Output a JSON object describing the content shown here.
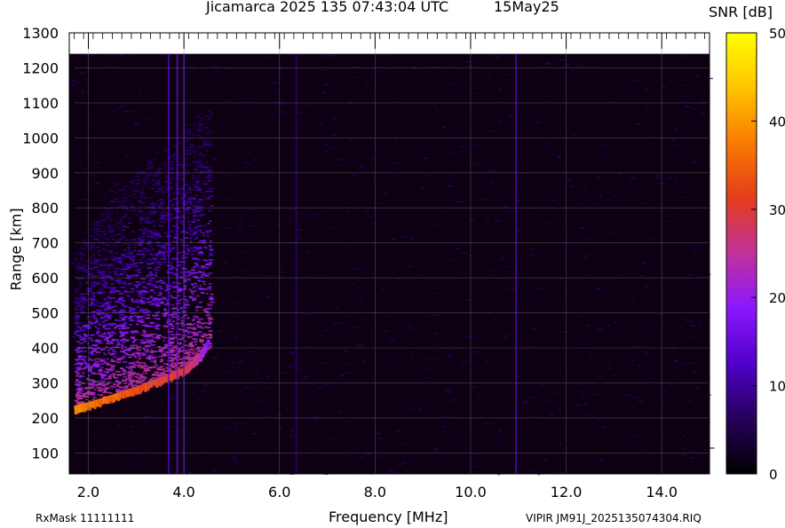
{
  "title": "Jicamarca 2025 135 07:43:04 UTC",
  "date": "15May25",
  "footer": {
    "rx_mask": "RxMask 11111111",
    "file_id": "VIPIR  JM91J_2025135074304.RIQ"
  },
  "chart_data": {
    "type": "heatmap",
    "xlabel": "Frequency [MHz]",
    "ylabel": "Range [km]",
    "xlim": [
      1.6,
      15.0
    ],
    "ylim": [
      40,
      1300
    ],
    "xticks": [
      2.0,
      4.0,
      6.0,
      8.0,
      10.0,
      12.0,
      14.0
    ],
    "xtick_labels": [
      "2.0",
      "4.0",
      "6.0",
      "8.0",
      "10.0",
      "12.0",
      "14.0"
    ],
    "yticks": [
      100,
      200,
      300,
      400,
      500,
      600,
      700,
      800,
      900,
      1000,
      1100,
      1200,
      1300
    ],
    "ytick_labels": [
      "100",
      "200",
      "300",
      "400",
      "500",
      "600",
      "700",
      "800",
      "900",
      "1000",
      "1100",
      "1200",
      "1300"
    ],
    "data_range_max": 1240,
    "grid": true,
    "colorbar": {
      "label": "SNR [dB]",
      "min": 0,
      "max": 50,
      "ticks": [
        0,
        10,
        20,
        30,
        40,
        50
      ],
      "tick_labels": [
        "0",
        "10",
        "20",
        "30",
        "40",
        "50"
      ],
      "colors": [
        "#000000",
        "#26005a",
        "#5000c8",
        "#8a18ff",
        "#c0329a",
        "#e33d1c",
        "#f87a00",
        "#ffc400",
        "#ffff00"
      ]
    },
    "trace": {
      "description_points": [
        {
          "f": 1.7,
          "r": 230,
          "snr": 36
        },
        {
          "f": 2.0,
          "r": 240,
          "snr": 34
        },
        {
          "f": 2.5,
          "r": 262,
          "snr": 32
        },
        {
          "f": 3.0,
          "r": 285,
          "snr": 30
        },
        {
          "f": 3.5,
          "r": 310,
          "snr": 28
        },
        {
          "f": 4.0,
          "r": 340,
          "snr": 26
        },
        {
          "f": 4.3,
          "r": 375,
          "snr": 22
        },
        {
          "f": 4.5,
          "r": 420,
          "snr": 15
        }
      ]
    },
    "vertical_lines": [
      {
        "f": 3.68,
        "snr": 14
      },
      {
        "f": 3.86,
        "snr": 16
      },
      {
        "f": 4.0,
        "snr": 12
      },
      {
        "f": 6.35,
        "snr": 8
      },
      {
        "f": 10.95,
        "snr": 14
      }
    ]
  }
}
